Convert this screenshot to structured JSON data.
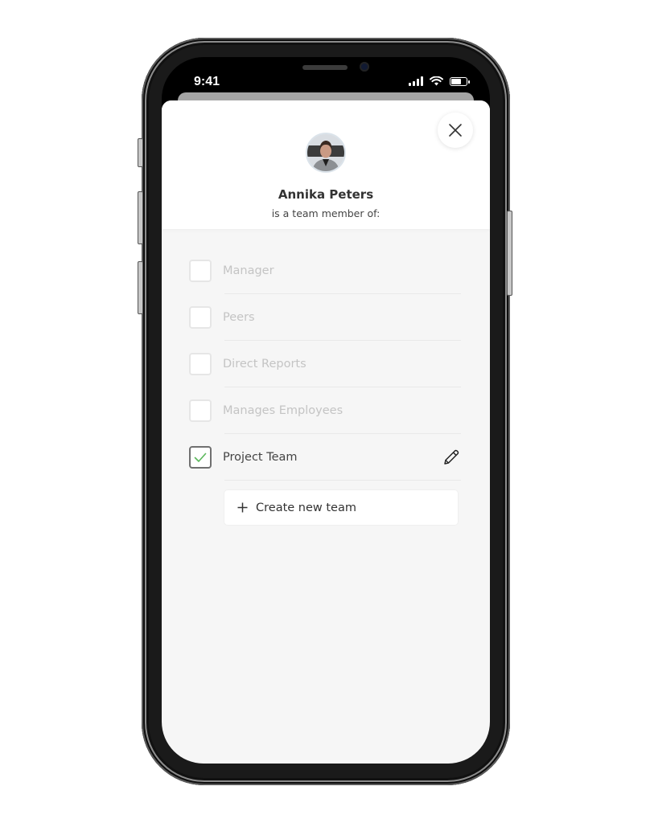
{
  "status_bar": {
    "time": "9:41",
    "icons": [
      "cellular-signal-icon",
      "wifi-icon",
      "battery-icon"
    ],
    "battery_level": 0.75
  },
  "sheet": {
    "close_icon": "close-icon",
    "person": {
      "name": "Annika Peters",
      "subtitle": "is a team member of:"
    },
    "teams": [
      {
        "label": "Manager",
        "checked": false,
        "editable": false
      },
      {
        "label": "Peers",
        "checked": false,
        "editable": false
      },
      {
        "label": "Direct Reports",
        "checked": false,
        "editable": false
      },
      {
        "label": "Manages Employees",
        "checked": false,
        "editable": false
      },
      {
        "label": "Project Team",
        "checked": true,
        "editable": true
      }
    ],
    "create_button": {
      "icon": "plus-icon",
      "label": "Create new team"
    }
  },
  "colors": {
    "check_green": "#5cb85c",
    "sheet_bg": "#f6f6f6",
    "text_dark": "#333333",
    "text_disabled": "#c4c4c4"
  }
}
